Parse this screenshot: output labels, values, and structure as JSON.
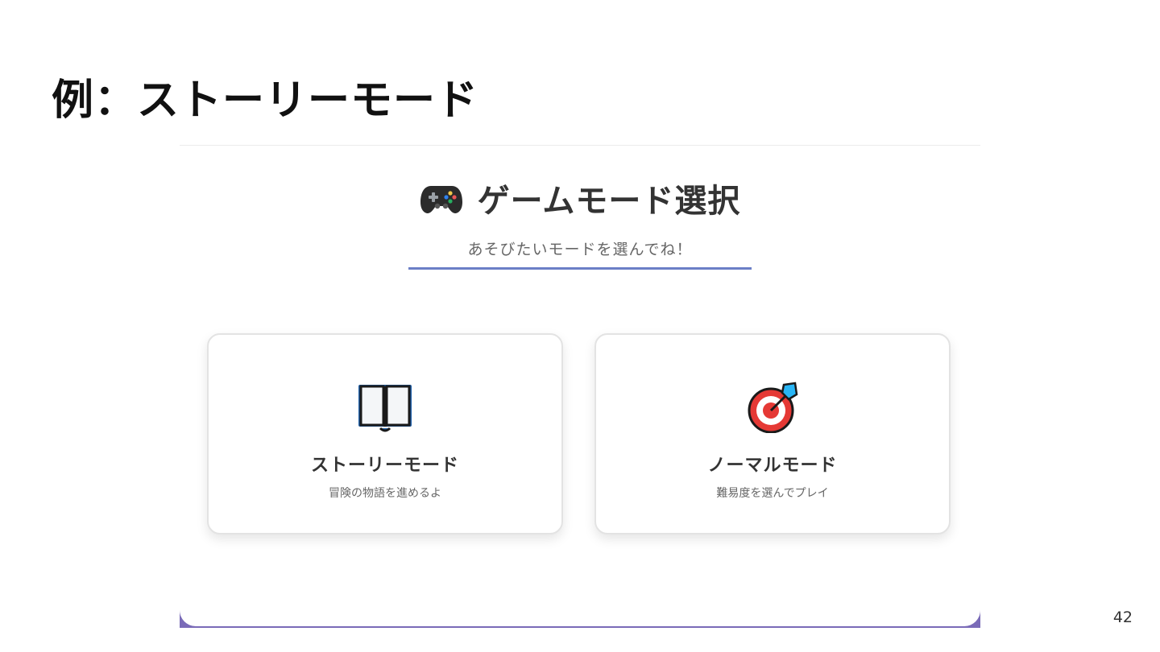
{
  "slide": {
    "title": "例：ストーリーモード",
    "page_number": "42"
  },
  "app": {
    "header": {
      "icon": "gamepad-icon",
      "title": "ゲームモード選択",
      "subtitle": "あそびたいモードを選んでね！",
      "accent_color": "#6b7fc6"
    },
    "modes": [
      {
        "icon": "open-book-icon",
        "title": "ストーリーモード",
        "description": "冒険の物語を進めるよ"
      },
      {
        "icon": "target-dart-icon",
        "title": "ノーマルモード",
        "description": "難易度を選んでプレイ"
      }
    ],
    "footer_color": "#7a6bb8"
  }
}
